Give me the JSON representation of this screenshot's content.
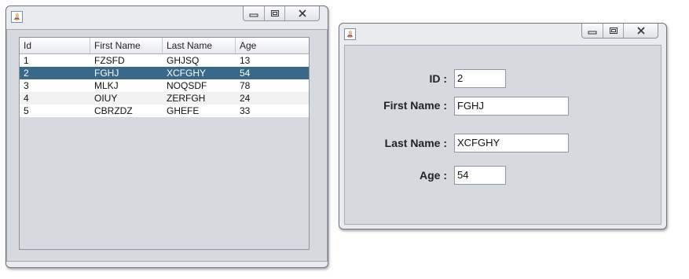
{
  "table_window": {
    "columns": [
      "Id",
      "First Name",
      "Last Name",
      "Age"
    ],
    "rows": [
      [
        "1",
        "FZSFD",
        "GHJSQ",
        "13"
      ],
      [
        "2",
        "FGHJ",
        "XCFGHY",
        "54"
      ],
      [
        "3",
        "MLKJ",
        "NOQSDF",
        "78"
      ],
      [
        "4",
        "OIUY",
        "ZERFGH",
        "24"
      ],
      [
        "5",
        "CBRZDZ",
        "GHEFE",
        "33"
      ]
    ],
    "selected_row": 1,
    "selected_color": "#39698a"
  },
  "form_window": {
    "id_label": "ID :",
    "id_value": "2",
    "first_name_label": "First Name :",
    "first_name_value": "FGHJ",
    "last_name_label": "Last Name :",
    "last_name_value": "XCFGHY",
    "age_label": "Age :",
    "age_value": "54"
  },
  "icons": {
    "app": "java-app-icon",
    "minimize": "minimize-icon",
    "maximize": "maximize-icon",
    "close": "close-icon"
  }
}
